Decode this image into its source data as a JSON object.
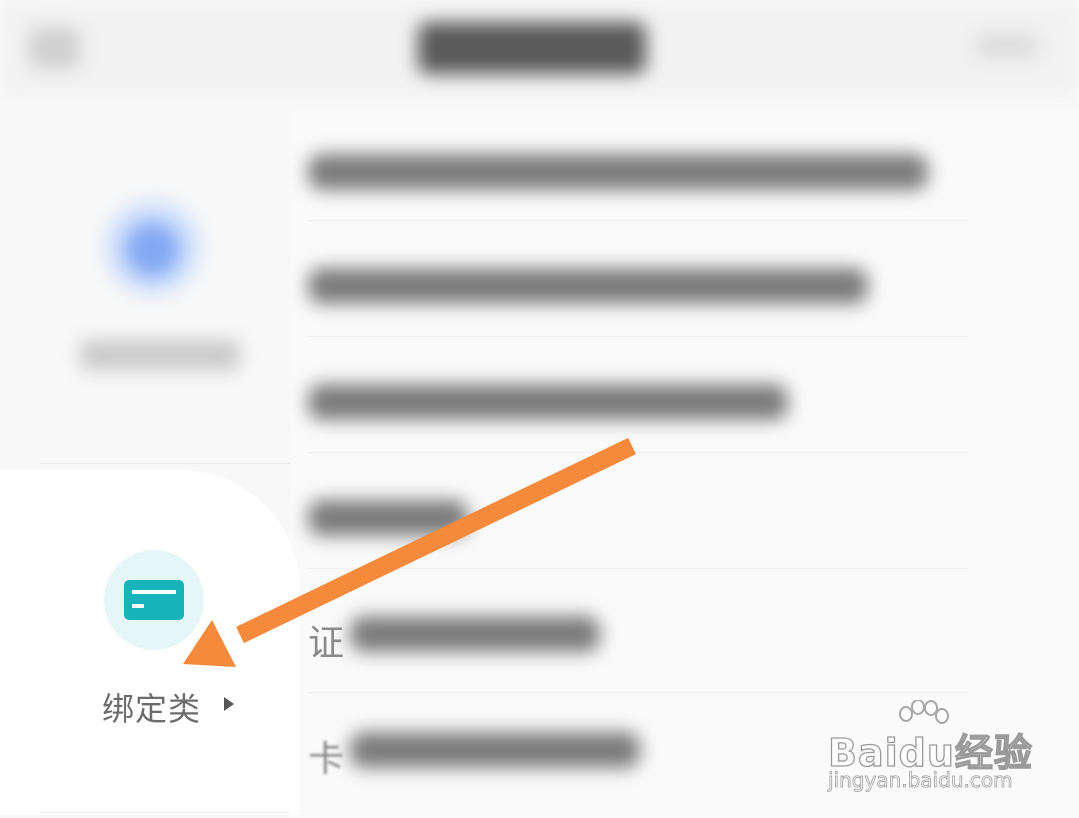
{
  "sidebar": {
    "selected_category": {
      "label": "绑定类",
      "icon": "card-icon",
      "color": "#17b3bb"
    },
    "other_category_icon_color": "#84a9f3"
  },
  "content": {
    "row_5_lead": "证",
    "row_6_lead": "卡"
  },
  "annotation": {
    "arrow_color": "#f58a3c"
  },
  "watermark": {
    "brand": "Baidu经验",
    "url": "jingyan.baidu.com"
  }
}
